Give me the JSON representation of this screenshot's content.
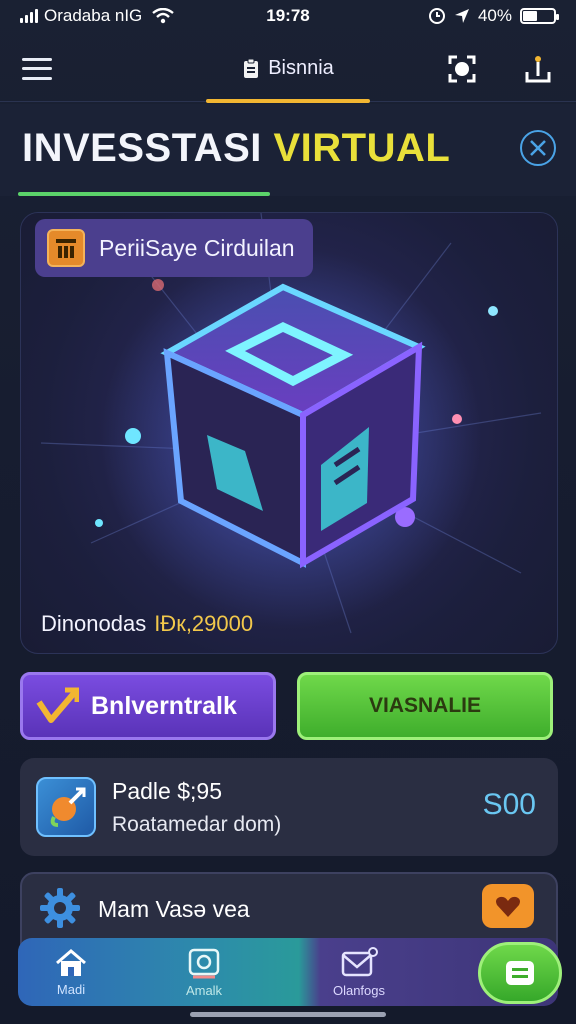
{
  "status_bar": {
    "carrier": "Oradaba nIG",
    "time": "19:78",
    "battery": "40%"
  },
  "topnav": {
    "title": "Bisnnia"
  },
  "page": {
    "title_part1": "INVESSTASI",
    "title_part2": "VIRTUAL"
  },
  "hero": {
    "pill_label": "PeriiSaye Cirduilan",
    "amount_label": "Dinonodas",
    "amount_value": "IĐк,29000"
  },
  "actions": {
    "left_label": "Bnlverntralk",
    "right_label": "VIASNALIE"
  },
  "list": {
    "row1_title": "Padle $;95",
    "row1_subtitle": "Roatamedar dom)",
    "row1_price": "S00",
    "row2_title": "Mam Vasə vea"
  },
  "tabbar": {
    "tab1": "Madi",
    "tab2": "Amalk",
    "tab3": "Olanfogs"
  },
  "colors": {
    "accent_yellow": "#e9e03a",
    "accent_green": "#5bd36a",
    "accent_purple": "#7a4ce0",
    "price_blue": "#6ac7f2"
  }
}
